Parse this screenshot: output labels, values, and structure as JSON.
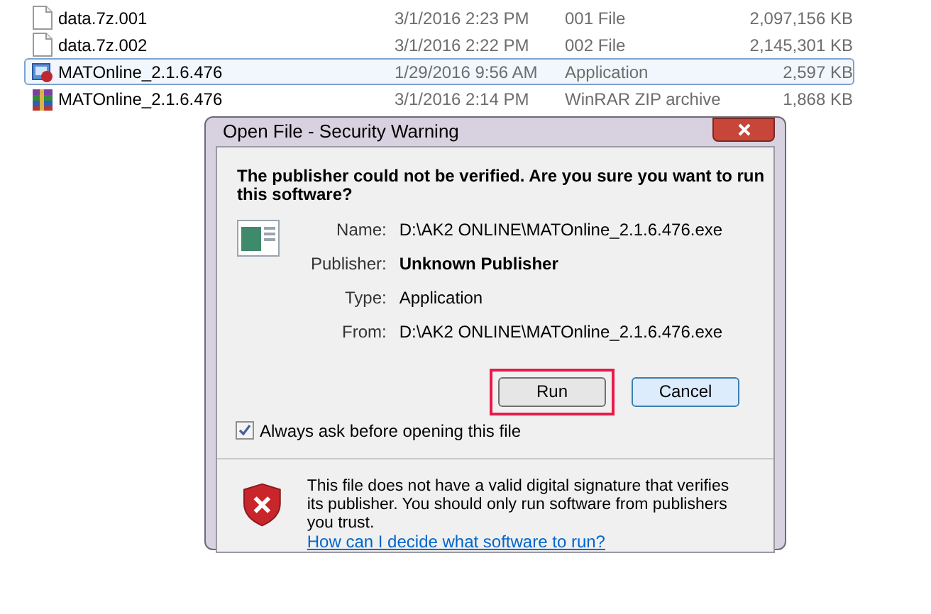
{
  "files": [
    {
      "kind": "file",
      "name": "data.7z.001",
      "date": "3/1/2016 2:23 PM",
      "type": "001 File",
      "size": "2,097,156 KB",
      "selected": false
    },
    {
      "kind": "file",
      "name": "data.7z.002",
      "date": "3/1/2016 2:22 PM",
      "type": "002 File",
      "size": "2,145,301 KB",
      "selected": false
    },
    {
      "kind": "app",
      "name": "MATOnline_2.1.6.476",
      "date": "1/29/2016 9:56 AM",
      "type": "Application",
      "size": "2,597 KB",
      "selected": true
    },
    {
      "kind": "archive",
      "name": "MATOnline_2.1.6.476",
      "date": "3/1/2016 2:14 PM",
      "type": "WinRAR ZIP archive",
      "size": "1,868 KB",
      "selected": false
    }
  ],
  "dialog": {
    "title": "Open File - Security Warning",
    "heading": "The publisher could not be verified.  Are you sure you want to run this software?",
    "details": [
      {
        "label": "Name:",
        "value": "D:\\AK2 ONLINE\\MATOnline_2.1.6.476.exe",
        "bold": false
      },
      {
        "label": "Publisher:",
        "value": "Unknown Publisher",
        "bold": true
      },
      {
        "label": "Type:",
        "value": "Application",
        "bold": false
      },
      {
        "label": "From:",
        "value": "D:\\AK2 ONLINE\\MATOnline_2.1.6.476.exe",
        "bold": false
      }
    ],
    "buttons": [
      {
        "label": "Run",
        "highlighted": true,
        "default": false
      },
      {
        "label": "Cancel",
        "highlighted": false,
        "default": true
      }
    ],
    "checkbox": {
      "label": "Always ask before opening this file",
      "checked": true
    },
    "warning": "This file does not have a valid digital signature that verifies its publisher.  You should only run software from publishers you trust.",
    "link": "How can I decide what software to run?"
  }
}
